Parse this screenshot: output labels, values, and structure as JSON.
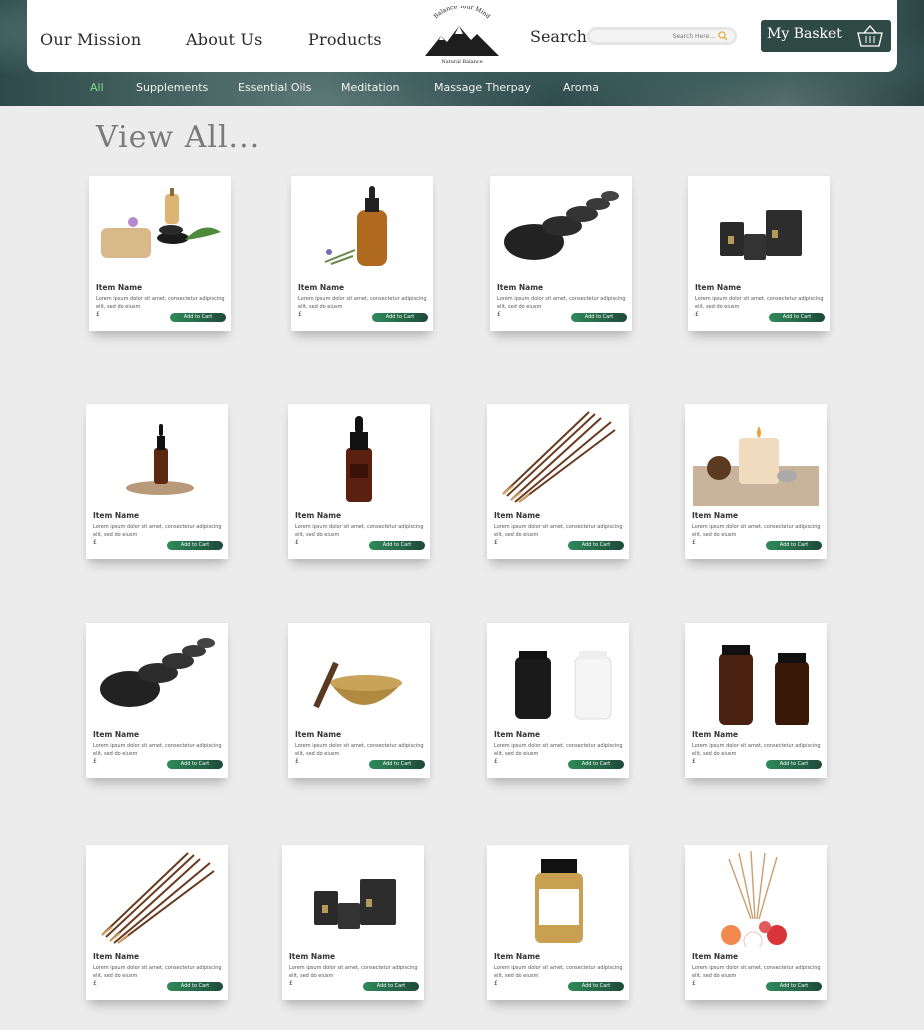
{
  "header": {
    "nav": [
      "Our Mission",
      "About Us",
      "Products"
    ],
    "logo_top_text": "Balance Your Mind",
    "logo_bottom_text": "Natural Balance",
    "search_label": "Search",
    "search_placeholder": "Search Here...",
    "basket_label": "My Basket"
  },
  "categories": [
    "All",
    "Supplements",
    "Essential Oils",
    "Meditation",
    "Massage Therpay",
    "Aroma"
  ],
  "page_title": "View All...",
  "products": [
    {
      "name": "Item Name",
      "desc": "Lorem ipsum dolor sit amet, consectetur adipiscing elit, sed do eiusm",
      "price": "£",
      "cta": "Add to Cart",
      "image": "spa-oil-stones-icon"
    },
    {
      "name": "Item Name",
      "desc": "Lorem ipsum dolor sit amet, consectetur adipiscing elit, sed do eiusm",
      "price": "£",
      "cta": "Add to Cart",
      "image": "amber-dropper-bottle-icon"
    },
    {
      "name": "Item Name",
      "desc": "Lorem ipsum dolor sit amet, consectetur adipiscing elit, sed do eiusm",
      "price": "£",
      "cta": "Add to Cart",
      "image": "hot-stones-icon"
    },
    {
      "name": "Item Name",
      "desc": "Lorem ipsum dolor sit amet, consectetur adipiscing elit, sed do eiusm",
      "price": "£",
      "cta": "Add to Cart",
      "image": "candle-jars-icon"
    },
    {
      "name": "Item Name",
      "desc": "Lorem ipsum dolor sit amet, consectetur adipiscing elit, sed do eiusm",
      "price": "£",
      "cta": "Add to Cart",
      "image": "dropper-on-stone-icon"
    },
    {
      "name": "Item Name",
      "desc": "Lorem ipsum dolor sit amet, consectetur adipiscing elit, sed do eiusm",
      "price": "£",
      "cta": "Add to Cart",
      "image": "dark-dropper-bottle-icon"
    },
    {
      "name": "Item Name",
      "desc": "Lorem ipsum dolor sit amet, consectetur adipiscing elit, sed do eiusm",
      "price": "£",
      "cta": "Add to Cart",
      "image": "incense-sticks-icon"
    },
    {
      "name": "Item Name",
      "desc": "Lorem ipsum dolor sit amet, consectetur adipiscing elit, sed do eiusm",
      "price": "£",
      "cta": "Add to Cart",
      "image": "candle-pinecone-icon"
    },
    {
      "name": "Item Name",
      "desc": "Lorem ipsum dolor sit amet, consectetur adipiscing elit, sed do eiusm",
      "price": "£",
      "cta": "Add to Cart",
      "image": "hot-stones-icon"
    },
    {
      "name": "Item Name",
      "desc": "Lorem ipsum dolor sit amet, consectetur adipiscing elit, sed do eiusm",
      "price": "£",
      "cta": "Add to Cart",
      "image": "singing-bowl-icon"
    },
    {
      "name": "Item Name",
      "desc": "Lorem ipsum dolor sit amet, consectetur adipiscing elit, sed do eiusm",
      "price": "£",
      "cta": "Add to Cart",
      "image": "supplement-jars-icon"
    },
    {
      "name": "Item Name",
      "desc": "Lorem ipsum dolor sit amet, consectetur adipiscing elit, sed do eiusm",
      "price": "£",
      "cta": "Add to Cart",
      "image": "amber-jars-icon"
    },
    {
      "name": "Item Name",
      "desc": "Lorem ipsum dolor sit amet, consectetur adipiscing elit, sed do eiusm",
      "price": "£",
      "cta": "Add to Cart",
      "image": "incense-sticks-icon"
    },
    {
      "name": "Item Name",
      "desc": "Lorem ipsum dolor sit amet, consectetur adipiscing elit, sed do eiusm",
      "price": "£",
      "cta": "Add to Cart",
      "image": "candle-jars-icon"
    },
    {
      "name": "Item Name",
      "desc": "Lorem ipsum dolor sit amet, consectetur adipiscing elit, sed do eiusm",
      "price": "£",
      "cta": "Add to Cart",
      "image": "amber-jar-label-icon"
    },
    {
      "name": "Item Name",
      "desc": "Lorem ipsum dolor sit amet, consectetur adipiscing elit, sed do eiusm",
      "price": "£",
      "cta": "Add to Cart",
      "image": "reed-diffuser-flowers-icon"
    }
  ]
}
